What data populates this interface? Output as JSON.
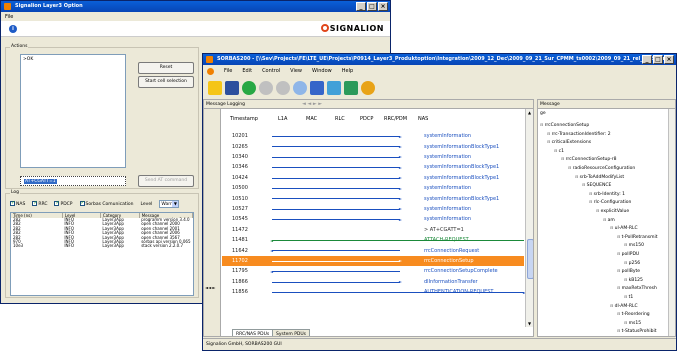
{
  "opt_window": {
    "title": "Signalion Layer3 Option",
    "menu": [
      "File"
    ],
    "logo_text": "SIGNALION",
    "actions_group": "Actions",
    "actions_text": ">OK",
    "reset_label": "Reset",
    "start_cell_label": "Start cell selection",
    "command_value": "AT+CGATT=1",
    "send_label": "Send AT command",
    "log_group": "Log",
    "filters": [
      {
        "label": "NAS",
        "checked": true
      },
      {
        "label": "RRC",
        "checked": true
      },
      {
        "label": "PDCP",
        "checked": true
      },
      {
        "label": "Sorbas Comunication",
        "checked": true
      }
    ],
    "level_label": "Level",
    "level_value": "Warn",
    "log_columns": [
      "Time (ns)",
      "Level",
      "Category",
      "Message"
    ],
    "log_rows": [
      [
        "282",
        "INFO",
        "Layer3App",
        "programm version 3.4.0"
      ],
      [
        "282",
        "INFO",
        "Layer3App",
        "open channel 2000"
      ],
      [
        "282",
        "INFO",
        "Layer3App",
        "open channel 2001"
      ],
      [
        "282",
        "INFO",
        "Layer3App",
        "open channel 2006"
      ],
      [
        "282",
        "INFO",
        "Layer3App",
        "open channel 3567"
      ],
      [
        "970",
        "INFO",
        "Layer3App",
        "sorbas api version 0.065"
      ],
      [
        "10e3",
        "INFO",
        "Layer3App",
        "stack version 2.2.0.7"
      ]
    ]
  },
  "main_window": {
    "title": "SORBAS200 - [\\\\Sev\\Projects\\FE\\LTE_UE\\Projects\\P0914_Layer3_Produktoption\\Integration\\2009_12_Dec\\2009_09_21_Sur_CPMM_ts0002\\2009_09_21_rel_002_par...]",
    "menu": [
      "File",
      "Edit",
      "Control",
      "View",
      "Window",
      "Help"
    ],
    "panel_title": "Message Logging",
    "columns": [
      "Timestamp",
      "L1A",
      "MAC",
      "RLC",
      "PDCP",
      "RRC/PDM",
      "NAS"
    ],
    "messages": [
      {
        "ts": "10201",
        "name": "systemInformation",
        "dir": "right",
        "selected": false
      },
      {
        "ts": "10265",
        "name": "systemInformationBlockType1",
        "dir": "right",
        "selected": false
      },
      {
        "ts": "10340",
        "name": "systemInformation",
        "dir": "right",
        "selected": false
      },
      {
        "ts": "10346",
        "name": "systemInformationBlockType1",
        "dir": "right",
        "selected": false
      },
      {
        "ts": "10424",
        "name": "systemInformationBlockType1",
        "dir": "right",
        "selected": false
      },
      {
        "ts": "10500",
        "name": "systemInformation",
        "dir": "right",
        "selected": false
      },
      {
        "ts": "10510",
        "name": "systemInformationBlockType1",
        "dir": "right",
        "selected": false
      },
      {
        "ts": "10527",
        "name": "systemInformation",
        "dir": "right",
        "selected": false
      },
      {
        "ts": "10545",
        "name": "systemInformation",
        "dir": "right",
        "selected": false
      },
      {
        "ts": "11472",
        "name": "> AT+CGATT=1",
        "dir": "none",
        "selected": false
      },
      {
        "ts": "11481",
        "name": "ATTACH-REQUEST",
        "dir": "left-long",
        "selected": false
      },
      {
        "ts": "11642",
        "name": "rrcConnectionRequest",
        "dir": "left",
        "selected": false
      },
      {
        "ts": "11702",
        "name": "rrcConnectionSetup",
        "dir": "right",
        "selected": true
      },
      {
        "ts": "11795",
        "name": "rrcConnectionSetupComplete",
        "dir": "left",
        "selected": false
      },
      {
        "ts": "11866",
        "name": "dlInformationTransfer",
        "dir": "right",
        "selected": false
      },
      {
        "ts": "11856",
        "name": "AUTHENTICATION-REQUEST",
        "dir": "right-long",
        "selected": false
      }
    ],
    "tabs": [
      "RRC/NAS PDUs",
      "System PDUs"
    ],
    "status": "Signalion GmbH, SORBAS200 GUI",
    "detail_header": "Message",
    "detail_sub": "ge",
    "tree": [
      {
        "depth": 0,
        "text": "rrcConnectionSetup"
      },
      {
        "depth": 1,
        "text": "rrc-TransactionIdentifier: 2"
      },
      {
        "depth": 1,
        "text": "criticalExtensions"
      },
      {
        "depth": 2,
        "text": "c1"
      },
      {
        "depth": 3,
        "text": "rrcConnectionSetup-r8"
      },
      {
        "depth": 4,
        "text": "radioResourceConfiguration"
      },
      {
        "depth": 5,
        "text": "srb-ToAddModifyList"
      },
      {
        "depth": 6,
        "text": "SEQUENCE"
      },
      {
        "depth": 7,
        "text": "srb-Identity: 1"
      },
      {
        "depth": 7,
        "text": "rlc-Configuration"
      },
      {
        "depth": 8,
        "text": "explicitValue"
      },
      {
        "depth": 9,
        "text": "am"
      },
      {
        "depth": 10,
        "text": "ul-AM-RLC"
      },
      {
        "depth": 11,
        "text": "t-PollRetransmit"
      },
      {
        "depth": 12,
        "text": "ms150"
      },
      {
        "depth": 11,
        "text": "pollPDU"
      },
      {
        "depth": 12,
        "text": "p256"
      },
      {
        "depth": 11,
        "text": "pollByte"
      },
      {
        "depth": 12,
        "text": "kB125"
      },
      {
        "depth": 11,
        "text": "maxRetxThresh"
      },
      {
        "depth": 12,
        "text": "t1"
      },
      {
        "depth": 10,
        "text": "dl-AM-RLC"
      },
      {
        "depth": 11,
        "text": "t-Reordering"
      },
      {
        "depth": 12,
        "text": "ms15"
      },
      {
        "depth": 11,
        "text": "t-StatusProhibit"
      }
    ]
  }
}
